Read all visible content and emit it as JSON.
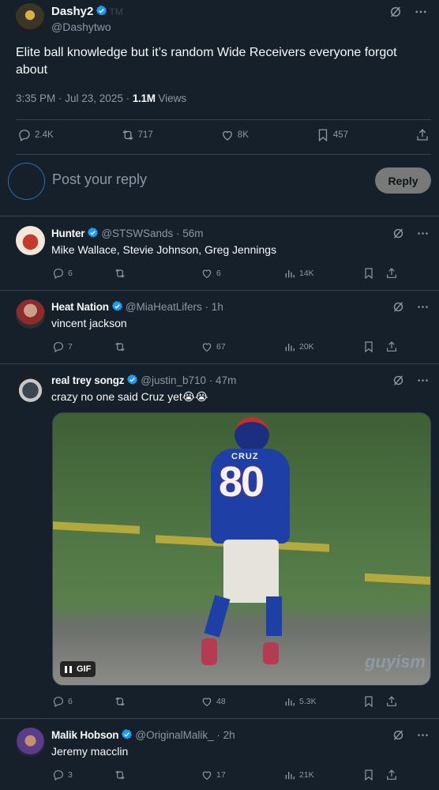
{
  "main_tweet": {
    "author_name": "Dashy2",
    "author_ghost_text": "TM",
    "author_handle": "@Dashytwo",
    "text": "Elite ball knowledge but it’s random Wide Receivers everyone forgot about",
    "time": "3:35 PM · Jul 23, 2025 · ",
    "views_count": "1.1M",
    "views_label": " Views",
    "stats": {
      "replies": "2.4K",
      "retweets": "717",
      "likes": "8K",
      "bookmarks": "457"
    }
  },
  "reply_box": {
    "placeholder": "Post your reply",
    "button_label": "Reply"
  },
  "replies": [
    {
      "name": "Hunter",
      "handle": "@STSWSands",
      "time": " · 56m",
      "text": "Mike Wallace, Stevie Johnson, Greg Jennings",
      "replies": "6",
      "retweets": "",
      "likes": "6",
      "views": "14K",
      "avatar_color": "#c23a2c"
    },
    {
      "name": "Heat Nation",
      "handle": "@MiaHeatLifers",
      "time": " · 1h",
      "text": "vincent jackson",
      "replies": "7",
      "retweets": "",
      "likes": "67",
      "views": "20K",
      "avatar_color": "#c9a18a"
    },
    {
      "name": "real trey songz",
      "handle": "@justin_b710",
      "time": " · 47m",
      "text": "crazy no one said Cruz yet😭😭",
      "replies": "6",
      "retweets": "",
      "likes": "48",
      "views": "5.3K",
      "avatar_color": "#3b4650",
      "gif": {
        "badge": "GIF",
        "jersey_name": "CRUZ",
        "jersey_number": "80",
        "watermark": "guyism"
      }
    },
    {
      "name": "Malik Hobson",
      "handle": "@OriginalMalik_",
      "time": " · 2h",
      "text": "Jeremy macclin",
      "replies": "3",
      "retweets": "",
      "likes": "17",
      "views": "21K",
      "avatar_color": "#5a3d8a"
    }
  ],
  "colors": {
    "background": "#15202b",
    "verified": "#1d9bf0",
    "muted_text": "#8b98a5",
    "divider": "#38444d"
  }
}
